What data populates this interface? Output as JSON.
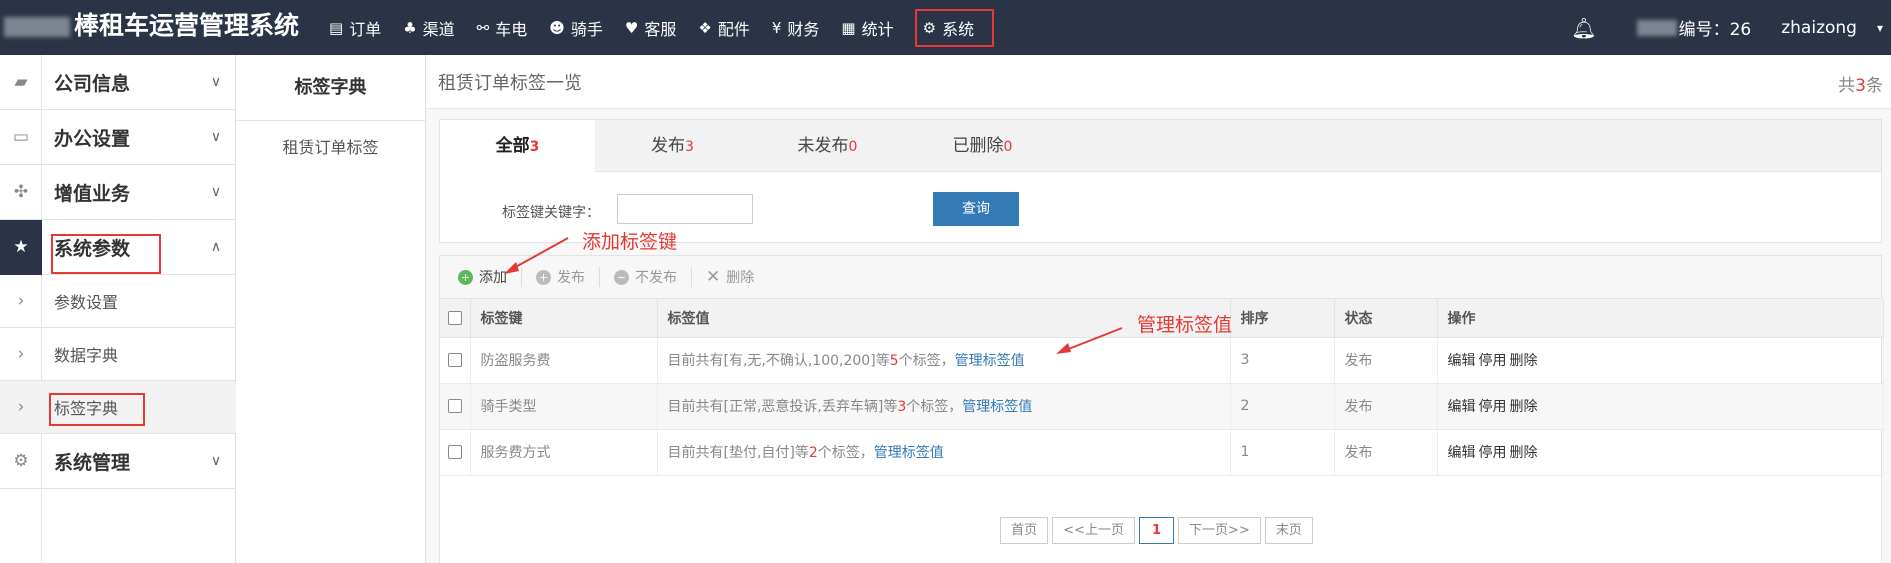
{
  "header": {
    "app_title": "棒租车运营管理系统",
    "nav": [
      {
        "label": "订单",
        "icon": "list-icon"
      },
      {
        "label": "渠道",
        "icon": "sitemap-icon"
      },
      {
        "label": "车电",
        "icon": "motorbike-icon"
      },
      {
        "label": "骑手",
        "icon": "users-icon"
      },
      {
        "label": "客服",
        "icon": "heart-icon"
      },
      {
        "label": "配件",
        "icon": "cubes-icon"
      },
      {
        "label": "财务",
        "icon": "yen-icon"
      },
      {
        "label": "统计",
        "icon": "chart-icon"
      },
      {
        "label": "系统",
        "icon": "gear-icon"
      }
    ],
    "user_code": "编号：26",
    "username": "zhaizong"
  },
  "left_menu": {
    "company": "公司信息",
    "office": "办公设置",
    "value_added": "增值业务",
    "system_params": "系统参数",
    "param_settings": "参数设置",
    "data_dict": "数据字典",
    "tag_dict": "标签字典",
    "system_mgmt": "系统管理"
  },
  "sub_nav": {
    "title": "标签字典",
    "item": "租赁订单标签"
  },
  "main": {
    "title": "租赁订单标签一览",
    "total_prefix": "共",
    "total": "3",
    "total_suffix": "条",
    "tabs": [
      {
        "label": "全部",
        "count": "3"
      },
      {
        "label": "发布",
        "count": "3"
      },
      {
        "label": "未发布",
        "count": "0"
      },
      {
        "label": "已删除",
        "count": "0"
      }
    ],
    "filter_label": "标签键关键字：",
    "filter_value": "",
    "query_button": "查询",
    "toolbar": {
      "add": "添加",
      "publish": "发布",
      "unpublish": "不发布",
      "delete": "删除"
    },
    "columns": [
      "标签键",
      "标签值",
      "排序",
      "状态",
      "操作"
    ],
    "rows": [
      {
        "key": "防盗服务费",
        "value_prefix": "目前共有[有,无,不确认,100,200]等",
        "count": "5",
        "value_suffix": "个标签，",
        "manage": "管理标签值",
        "order": "3",
        "status": "发布",
        "edit": "编辑",
        "disable": "停用",
        "delete": "删除"
      },
      {
        "key": "骑手类型",
        "value_prefix": "目前共有[正常,恶意投诉,丢弃车辆]等",
        "count": "3",
        "value_suffix": "个标签，",
        "manage": "管理标签值",
        "order": "2",
        "status": "发布",
        "edit": "编辑",
        "disable": "停用",
        "delete": "删除"
      },
      {
        "key": "服务费方式",
        "value_prefix": "目前共有[垫付,自付]等",
        "count": "2",
        "value_suffix": "个标签，",
        "manage": "管理标签值",
        "order": "1",
        "status": "发布",
        "edit": "编辑",
        "disable": "停用",
        "delete": "删除"
      }
    ],
    "pager": {
      "first": "首页",
      "prev": "<<上一页",
      "current": "1",
      "next": "下一页>>",
      "last": "末页"
    }
  },
  "annotations": {
    "add_key": "添加标签键",
    "manage_value": "管理标签值"
  },
  "colors": {
    "topbar": "#2a3446",
    "accent_red": "#e53935",
    "link_blue": "#337ab7"
  }
}
